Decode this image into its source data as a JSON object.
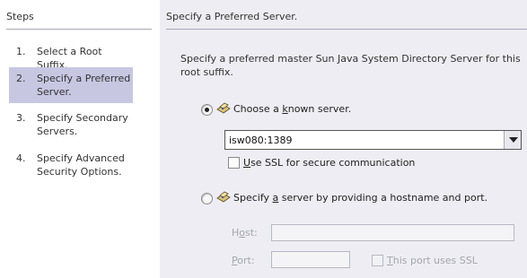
{
  "steps": {
    "title": "Steps",
    "items": [
      {
        "number": "1.",
        "label": "Select a Root Suffix."
      },
      {
        "number": "2.",
        "label": "Specify a Preferred Server.",
        "active": true
      },
      {
        "number": "3.",
        "label": "Specify Secondary Servers."
      },
      {
        "number": "4.",
        "label": "Specify Advanced Security Options."
      }
    ]
  },
  "main": {
    "title": "Specify a Preferred Server.",
    "description": "Specify a preferred master Sun Java System Directory Server for this root suffix.",
    "known_server": {
      "label_pre": "Choose a ",
      "label_mnemonic": "k",
      "label_post": "nown server.",
      "selected": true,
      "combo_value": "isw080:1389",
      "ssl_label_mnemonic": "U",
      "ssl_label_post": "se SSL for secure communication",
      "ssl_checked": false
    },
    "specify_server": {
      "label_pre": "Specify ",
      "label_mnemonic": "a",
      "label_post": " server by providing a hostname and port.",
      "selected": false,
      "host_label_pre": "H",
      "host_label_mnemonic": "o",
      "host_label_post": "st:",
      "host_value": "",
      "port_label_mnemonic": "P",
      "port_label_post": "ort:",
      "port_value": "",
      "port_ssl_label_mnemonic": "T",
      "port_ssl_label_post": "his port uses SSL",
      "port_ssl_checked": false
    }
  },
  "colors": {
    "active_step_bg": "#c7c7e2",
    "content_bg": "#ededf3",
    "disabled_text": "#a5a5ad"
  },
  "icons": {
    "server": "server-icon",
    "dropdown": "chevron-down-icon"
  }
}
